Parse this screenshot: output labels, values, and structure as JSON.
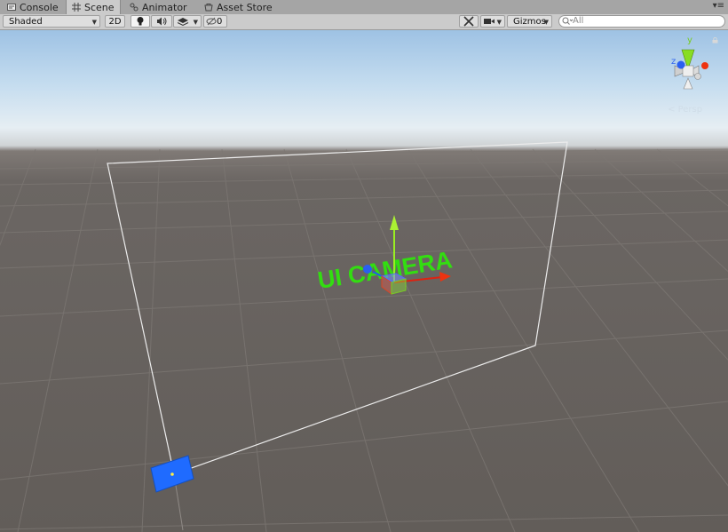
{
  "tabs": [
    {
      "label": "Console",
      "icon": "console-icon"
    },
    {
      "label": "Scene",
      "icon": "scene-grid-icon",
      "active": true
    },
    {
      "label": "Animator",
      "icon": "animator-icon"
    },
    {
      "label": "Asset Store",
      "icon": "asset-store-icon"
    }
  ],
  "toolbar": {
    "shading_mode": "Shaded",
    "mode_2d": "2D",
    "hidden_count": "0",
    "gizmos_label": "Gizmos",
    "search_placeholder": "All"
  },
  "scene": {
    "camera_label": "UI CAMERA",
    "projection_label": "Persp",
    "gizmo_axes": {
      "y": "y",
      "z": "z"
    }
  },
  "colors": {
    "sky": "#b4d2ec",
    "ground": "#625d59",
    "label_green": "#33dd11",
    "axis_x": "#dd2211",
    "axis_y": "#99ee22",
    "axis_z": "#2255ee",
    "canvas_outline": "#e8e8e8",
    "selected_quad": "#1f6bff"
  }
}
